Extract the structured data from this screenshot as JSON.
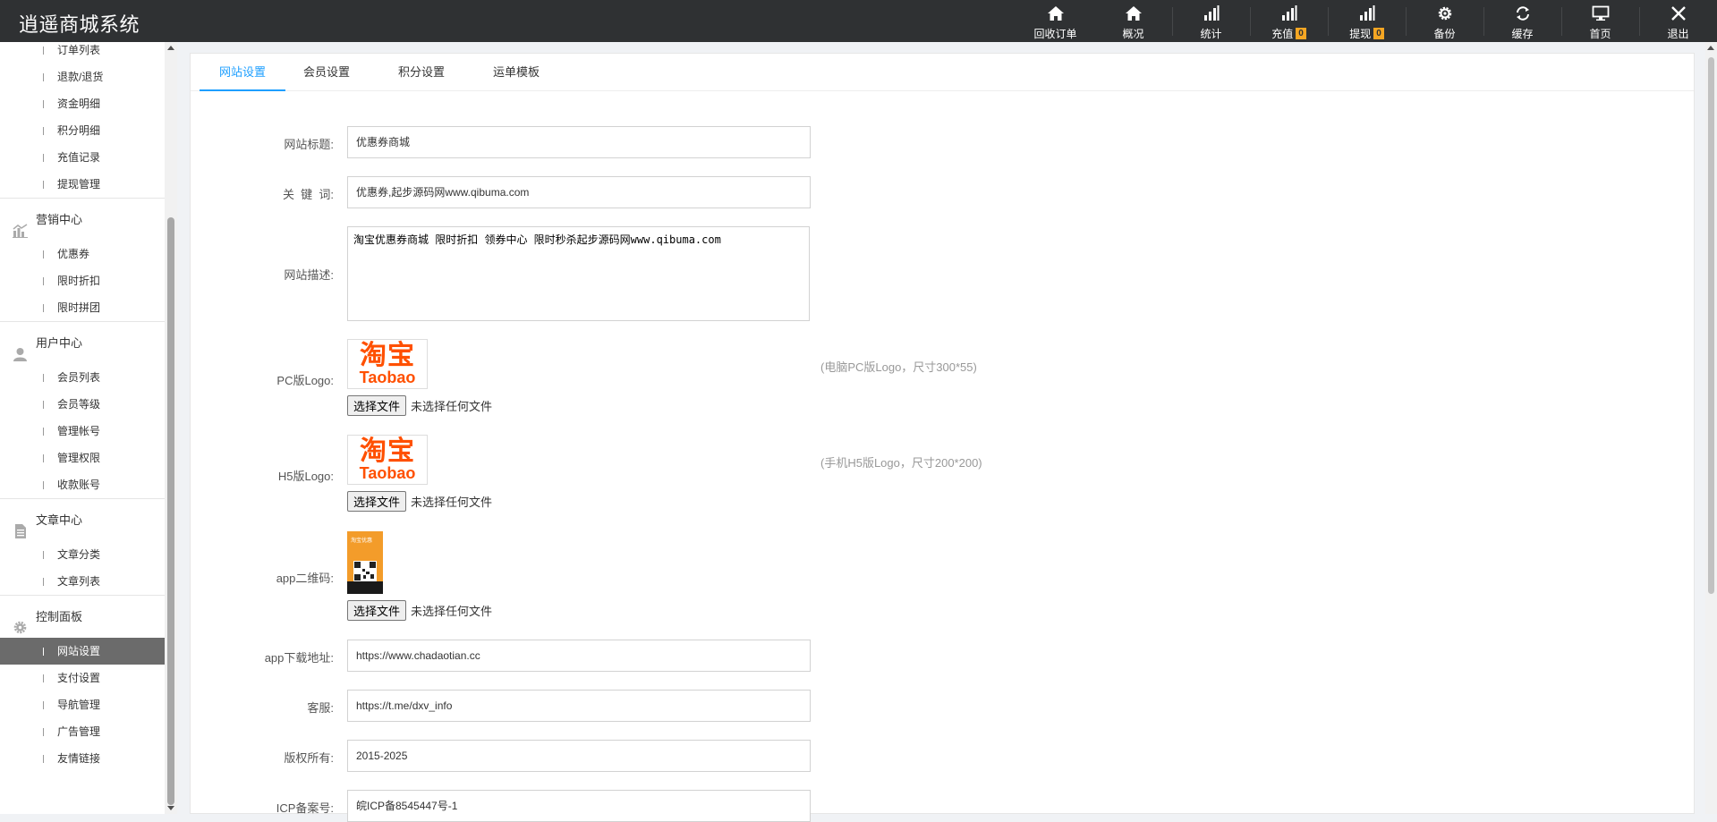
{
  "app": {
    "title": "逍遥商城系统"
  },
  "top_nav": [
    {
      "label": "回收订单",
      "icon": "home-icon"
    },
    {
      "label": "概况",
      "icon": "home-icon"
    },
    {
      "label": "统计",
      "icon": "bar-chart-icon"
    },
    {
      "label": "充值",
      "icon": "bar-chart-icon",
      "badge": "0"
    },
    {
      "label": "提现",
      "icon": "bar-chart-icon",
      "badge": "0"
    },
    {
      "label": "备份",
      "icon": "gear-icon"
    },
    {
      "label": "缓存",
      "icon": "refresh-icon"
    },
    {
      "label": "首页",
      "icon": "monitor-icon"
    },
    {
      "label": "退出",
      "icon": "close-icon"
    }
  ],
  "sidebar": {
    "top_items": [
      "订单列表",
      "退款/退货",
      "资金明细",
      "积分明细",
      "充值记录",
      "提现管理"
    ],
    "groups": [
      {
        "label": "营销中心",
        "icon": "chart-icon",
        "items": [
          "优惠券",
          "限时折扣",
          "限时拼团"
        ]
      },
      {
        "label": "用户中心",
        "icon": "user-icon",
        "items": [
          "会员列表",
          "会员等级",
          "管理帐号",
          "管理权限",
          "收款账号"
        ]
      },
      {
        "label": "文章中心",
        "icon": "document-icon",
        "items": [
          "文章分类",
          "文章列表"
        ]
      },
      {
        "label": "控制面板",
        "icon": "gear-icon",
        "items": [
          "网站设置",
          "支付设置",
          "导航管理",
          "广告管理",
          "友情链接"
        ]
      }
    ],
    "active_item": "网站设置"
  },
  "tabs": [
    "网站设置",
    "会员设置",
    "积分设置",
    "运单模板"
  ],
  "active_tab": "网站设置",
  "form": {
    "site_title": {
      "label": "网站标题:",
      "value": "优惠券商城"
    },
    "keywords": {
      "label": "关  键  词:",
      "value": "优惠券,起步源码网www.qibuma.com"
    },
    "description": {
      "label": "网站描述:",
      "value": "淘宝优惠券商城 限时折扣 领券中心 限时秒杀起步源码网www.qibuma.com"
    },
    "pc_logo": {
      "label": "PC版Logo:",
      "hint": "(电脑PC版Logo，尺寸300*55)"
    },
    "h5_logo": {
      "label": "H5版Logo:",
      "hint": "(手机H5版Logo，尺寸200*200)"
    },
    "app_qrcode": {
      "label": "app二维码:"
    },
    "app_url": {
      "label": "app下载地址:",
      "value": "https://www.chadaotian.cc"
    },
    "service": {
      "label": "客服:",
      "value": "https://t.me/dxv_info"
    },
    "copyright": {
      "label": "版权所有:",
      "value": "2015-2025"
    },
    "icp": {
      "label": "ICP备案号:",
      "value": "皖ICP备8545447号-1"
    }
  },
  "file_input": {
    "button": "选择文件",
    "status": "未选择任何文件"
  },
  "logo_image": {
    "cn": "淘宝",
    "en": "Taobao"
  },
  "qr_image": {
    "title": "淘宝优惠"
  },
  "colors": {
    "topbar": "#2f3133",
    "accent": "#1e9fff",
    "badge": "#f5a623",
    "logo": "#ff5000",
    "active_side": "#6b6b6b"
  }
}
